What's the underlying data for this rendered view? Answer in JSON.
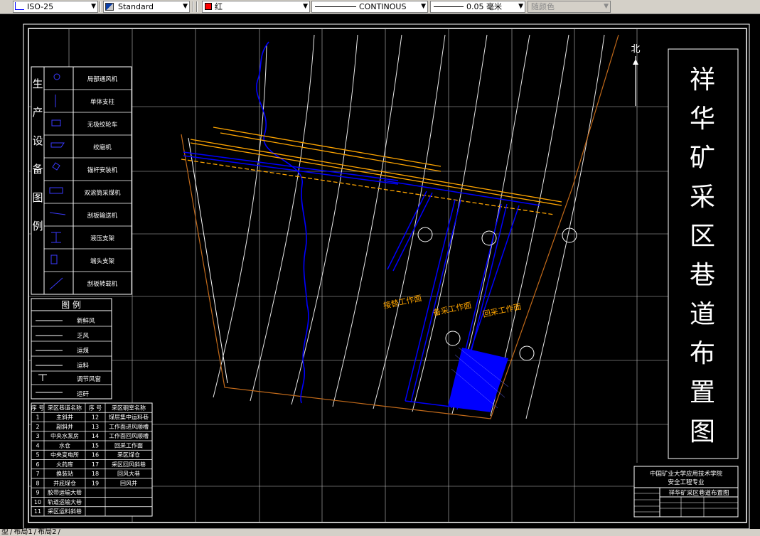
{
  "toolbar": {
    "dimstyle": "ISO-25",
    "textstyle": "Standard",
    "color": "红",
    "color_hex": "#ff0000",
    "linetype": "CONTINOUS",
    "lineweight": "0.05 毫米",
    "plotstyle": "随颜色"
  },
  "drawing": {
    "title": "祥华矿采区巷道布置图",
    "north_label": "北",
    "equipment_legend_title": "生产设备图例",
    "equipment_items": [
      "局部通风机",
      "单体支柱",
      "无极绞轮车",
      "绞磨机",
      "锚杆安装机",
      "双滚筒采煤机",
      "刮板输送机",
      "液压支架",
      "端头支架",
      "刮板转载机"
    ],
    "legend_title": "图  例",
    "legend_items": [
      "新鲜风",
      "乏风",
      "运煤",
      "运料",
      "调节风窗",
      "运矸"
    ],
    "roadway_table": {
      "headers": [
        "序 号",
        "采区巷道名称",
        "序 号",
        "采区硐室名称"
      ],
      "rows": [
        [
          "1",
          "主斜井",
          "12",
          "煤层集中运料巷"
        ],
        [
          "2",
          "副斜井",
          "13",
          "工作面进风顺槽"
        ],
        [
          "3",
          "中央水泵房",
          "14",
          "工作面回风顺槽"
        ],
        [
          "4",
          "水仓",
          "15",
          "回采工作面"
        ],
        [
          "5",
          "中央变电所",
          "16",
          "采区煤仓"
        ],
        [
          "6",
          "火药库",
          "17",
          "采区回风斜巷"
        ],
        [
          "7",
          "换装站",
          "18",
          "回风大巷"
        ],
        [
          "8",
          "井底煤仓",
          "19",
          "回风井"
        ],
        [
          "9",
          "胶带运输大巷",
          "",
          ""
        ],
        [
          "10",
          "轨道运输大巷",
          "",
          ""
        ],
        [
          "11",
          "采区运料斜巷",
          "",
          ""
        ]
      ]
    },
    "work_faces": [
      "接替工作面",
      "备采工作面",
      "回采工作面"
    ],
    "title_block": {
      "school_line1": "中国矿业大学应用技术学院",
      "school_line2": "安全工程专业",
      "drawing_name": "祥华矿采区巷道布置图"
    }
  },
  "layout_tabs": [
    "型",
    "布局1",
    "布局2"
  ]
}
